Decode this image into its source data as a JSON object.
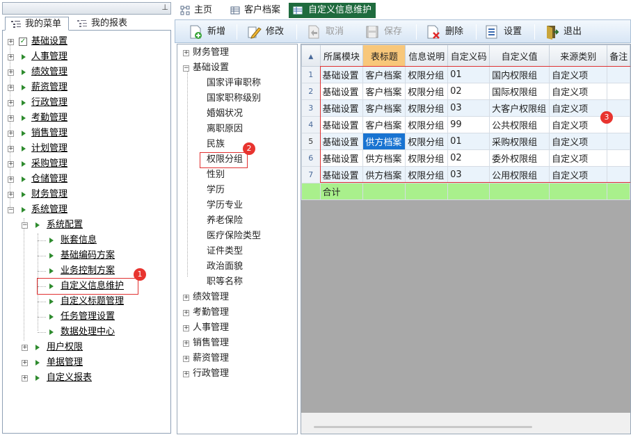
{
  "left_panel": {
    "pin_glyph": "⊥",
    "tabs": [
      {
        "label": "我的菜单",
        "icon": "menu-tree-icon",
        "active": true
      },
      {
        "label": "我的报表",
        "icon": "report-tree-icon",
        "active": false
      }
    ],
    "tree": {
      "root": "基础设置",
      "modules": [
        "人事管理",
        "绩效管理",
        "薪资管理",
        "行政管理",
        "考勤管理",
        "销售管理",
        "计划管理",
        "采购管理",
        "仓储管理",
        "财务管理",
        "系统管理"
      ],
      "system_config": "系统配置",
      "system_config_children": [
        "账套信息",
        "基础编码方案",
        "业务控制方案",
        "自定义信息维护",
        "自定义标题管理",
        "任务管理设置",
        "数据处理中心"
      ],
      "system_tail": [
        "用户权限",
        "单据管理",
        "自定义报表"
      ]
    },
    "badge_1": "1"
  },
  "doc_tabs": [
    {
      "label": "主页",
      "icon": "home-icon"
    },
    {
      "label": "客户档案",
      "icon": "table-icon"
    },
    {
      "label": "自定义信息维护",
      "icon": "table-icon",
      "active": true
    }
  ],
  "toolbar": {
    "new": "新增",
    "edit": "修改",
    "cancel": "取消",
    "save": "保存",
    "delete": "删除",
    "settings": "设置",
    "exit": "退出"
  },
  "mid_tree": {
    "top": "财务管理",
    "base": "基础设置",
    "base_children": [
      "国家评审职称",
      "国家职称级别",
      "婚姻状况",
      "离职原因",
      "民族",
      "权限分组",
      "性别",
      "学历",
      "学历专业",
      "养老保险",
      "医疗保险类型",
      "证件类型",
      "政治面貌",
      "职等名称"
    ],
    "rest": [
      "绩效管理",
      "考勤管理",
      "人事管理",
      "销售管理",
      "薪资管理",
      "行政管理"
    ],
    "badge_2": "2"
  },
  "grid": {
    "columns": [
      "所属模块",
      "表标题",
      "信息说明",
      "自定义码",
      "自定义值",
      "来源类别",
      "备注"
    ],
    "rows": [
      {
        "no": "1",
        "module": "基础设置",
        "table": "客户档案",
        "info": "权限分组",
        "code": "01",
        "value": "国内权限组",
        "source": "自定义项",
        "note": ""
      },
      {
        "no": "2",
        "module": "基础设置",
        "table": "客户档案",
        "info": "权限分组",
        "code": "02",
        "value": "国际权限组",
        "source": "自定义项",
        "note": ""
      },
      {
        "no": "3",
        "module": "基础设置",
        "table": "客户档案",
        "info": "权限分组",
        "code": "03",
        "value": "大客户权限组",
        "source": "自定义项",
        "note": ""
      },
      {
        "no": "4",
        "module": "基础设置",
        "table": "客户档案",
        "info": "权限分组",
        "code": "99",
        "value": "公共权限组",
        "source": "自定义项",
        "note": ""
      },
      {
        "no": "5",
        "module": "基础设置",
        "table": "供方档案",
        "info": "权限分组",
        "code": "01",
        "value": "采购权限组",
        "source": "自定义项",
        "note": ""
      },
      {
        "no": "6",
        "module": "基础设置",
        "table": "供方档案",
        "info": "权限分组",
        "code": "02",
        "value": "委外权限组",
        "source": "自定义项",
        "note": ""
      },
      {
        "no": "7",
        "module": "基础设置",
        "table": "供方档案",
        "info": "权限分组",
        "code": "03",
        "value": "公用权限组",
        "source": "自定义项",
        "note": ""
      }
    ],
    "total_label": "合计",
    "badge_3": "3"
  },
  "colors": {
    "accent_tab": "#1f6b3e",
    "selection": "#1873d1",
    "sum_row": "#a9f08c",
    "annotation": "#e03030"
  }
}
